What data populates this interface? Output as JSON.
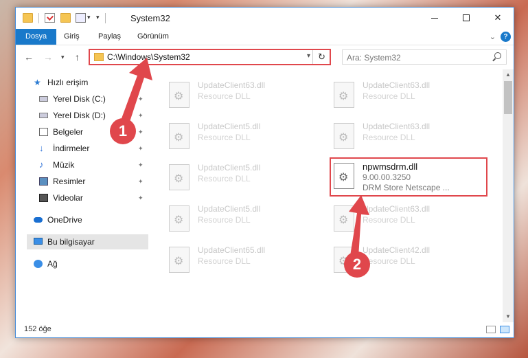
{
  "window": {
    "title": "System32"
  },
  "ribbon": {
    "tabs": [
      "Dosya",
      "Giriş",
      "Paylaş",
      "Görünüm"
    ],
    "collapse_icon": "chevron-down-icon",
    "help_label": "?"
  },
  "nav": {
    "address": "C:\\Windows\\System32",
    "search_placeholder": "Ara: System32"
  },
  "sidebar": {
    "items": [
      {
        "label": "Hızlı erişim",
        "icon": "star-icon",
        "pinned": false
      },
      {
        "label": "Yerel Disk (C:)",
        "icon": "disk-icon",
        "pinned": true
      },
      {
        "label": "Yerel Disk (D:)",
        "icon": "disk-icon",
        "pinned": true
      },
      {
        "label": "Belgeler",
        "icon": "document-icon",
        "pinned": true
      },
      {
        "label": "İndirmeler",
        "icon": "download-icon",
        "pinned": true
      },
      {
        "label": "Müzik",
        "icon": "music-icon",
        "pinned": true
      },
      {
        "label": "Resimler",
        "icon": "pictures-icon",
        "pinned": true
      },
      {
        "label": "Videolar",
        "icon": "video-icon",
        "pinned": true
      },
      {
        "label": "OneDrive",
        "icon": "cloud-icon",
        "pinned": false
      },
      {
        "label": "Bu bilgisayar",
        "icon": "computer-icon",
        "pinned": false,
        "selected": true
      },
      {
        "label": "Ağ",
        "icon": "network-icon",
        "pinned": false
      }
    ]
  },
  "files": [
    {
      "name": "UpdateClient63.dll",
      "type": "Resource DLL"
    },
    {
      "name": "UpdateClient63.dll",
      "type": "Resource DLL"
    },
    {
      "name": "UpdateClient5.dll",
      "type": "Resource DLL"
    },
    {
      "name": "UpdateClient63.dll",
      "type": "Resource DLL"
    },
    {
      "name": "UpdateClient5.dll",
      "type": "Resource DLL"
    },
    {
      "name": "npwmsdrm.dll",
      "version": "9.00.00.3250",
      "description": "DRM Store Netscape ...",
      "highlighted": true
    },
    {
      "name": "UpdateClient5.dll",
      "type": "Resource DLL"
    },
    {
      "name": "UpdateClient63.dll",
      "type": "Resource DLL"
    },
    {
      "name": "UpdateClient65.dll",
      "type": "Resource DLL"
    },
    {
      "name": "UpdateClient42.dll",
      "type": "Resource DLL"
    }
  ],
  "status": {
    "item_count": "152 öğe"
  },
  "annotations": {
    "step1": "1",
    "step2": "2",
    "color": "#e0474c"
  }
}
